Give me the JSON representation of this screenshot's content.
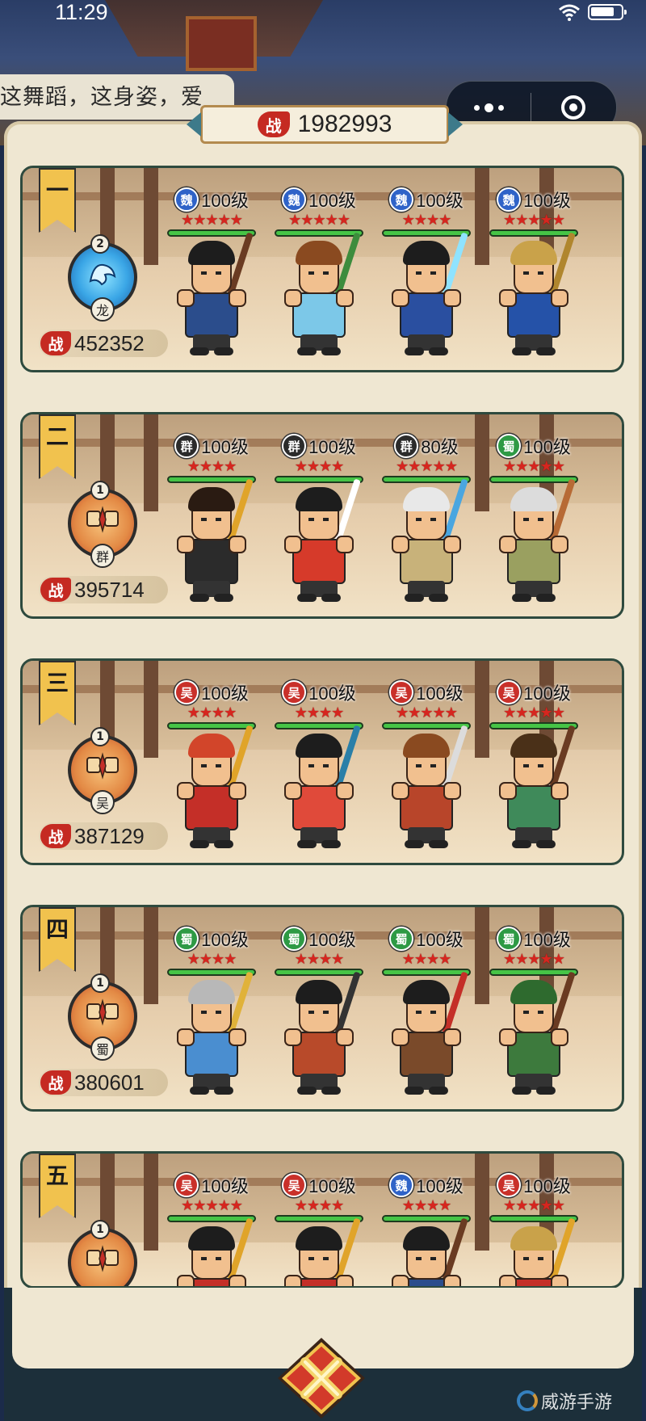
{
  "status_bar": {
    "time": "11:29"
  },
  "dialogue": {
    "text": "这舞蹈，这身姿，爱"
  },
  "total_power": {
    "badge": "战",
    "value": "1982993"
  },
  "teams": [
    {
      "rank": "一",
      "power": "452352",
      "formation_count": "2",
      "formation_label": "龙",
      "formation_style": "dragon",
      "heroes": [
        {
          "faction": "魏",
          "faction_color": "#2f63c8",
          "level": "100级",
          "stars": "★★★★★",
          "body_color": "#2b4d8c",
          "hair_color": "#1d1d1d",
          "weapon_color": "#6a3b22"
        },
        {
          "faction": "魏",
          "faction_color": "#2f63c8",
          "level": "100级",
          "stars": "★★★★★",
          "body_color": "#7cc8e8",
          "hair_color": "#8a4a20",
          "weapon_color": "#3d8c3d"
        },
        {
          "faction": "魏",
          "faction_color": "#2f63c8",
          "level": "100级",
          "stars": "★★★★",
          "body_color": "#2a4fa0",
          "hair_color": "#1d1d1d",
          "weapon_color": "#8fe3ff"
        },
        {
          "faction": "魏",
          "faction_color": "#2f63c8",
          "level": "100级",
          "stars": "★★★★★",
          "body_color": "#2552a8",
          "hair_color": "#c9a24a",
          "weapon_color": "#b0862e"
        }
      ]
    },
    {
      "rank": "二",
      "power": "395714",
      "formation_count": "1",
      "formation_label": "群",
      "formation_style": "fire",
      "heroes": [
        {
          "faction": "群",
          "faction_color": "#2b2b2b",
          "level": "100级",
          "stars": "★★★★",
          "body_color": "#2b2b2b",
          "hair_color": "#2a1b12",
          "weapon_color": "#e0a42a"
        },
        {
          "faction": "群",
          "faction_color": "#2b2b2b",
          "level": "100级",
          "stars": "★★★★",
          "body_color": "#d63a2a",
          "hair_color": "#1d1d1d",
          "weapon_color": "#ffffff"
        },
        {
          "faction": "群",
          "faction_color": "#2b2b2b",
          "level": "80级",
          "stars": "★★★★★",
          "body_color": "#c8b27a",
          "hair_color": "#e8e8e8",
          "weapon_color": "#4aa6e0"
        },
        {
          "faction": "蜀",
          "faction_color": "#2e9a45",
          "level": "100级",
          "stars": "★★★★★",
          "body_color": "#9aa060",
          "hair_color": "#dcdcdc",
          "weapon_color": "#b76a35"
        }
      ]
    },
    {
      "rank": "三",
      "power": "387129",
      "formation_count": "1",
      "formation_label": "吴",
      "formation_style": "fire",
      "heroes": [
        {
          "faction": "吴",
          "faction_color": "#c9302a",
          "level": "100级",
          "stars": "★★★★",
          "body_color": "#c42f28",
          "hair_color": "#d2452a",
          "weapon_color": "#e0a42a"
        },
        {
          "faction": "吴",
          "faction_color": "#c9302a",
          "level": "100级",
          "stars": "★★★★",
          "body_color": "#e04a3a",
          "hair_color": "#1d1d1d",
          "weapon_color": "#2a7fa8"
        },
        {
          "faction": "吴",
          "faction_color": "#c9302a",
          "level": "100级",
          "stars": "★★★★★",
          "body_color": "#b8452a",
          "hair_color": "#8a4a20",
          "weapon_color": "#dcdcdc"
        },
        {
          "faction": "吴",
          "faction_color": "#c9302a",
          "level": "100级",
          "stars": "★★★★★",
          "body_color": "#3f8a5a",
          "hair_color": "#4a3018",
          "weapon_color": "#6a3b22"
        }
      ]
    },
    {
      "rank": "四",
      "power": "380601",
      "formation_count": "1",
      "formation_label": "蜀",
      "formation_style": "fire",
      "heroes": [
        {
          "faction": "蜀",
          "faction_color": "#2e9a45",
          "level": "100级",
          "stars": "★★★★",
          "body_color": "#4a8ed0",
          "hair_color": "#b8b8b8",
          "weapon_color": "#e0b23a"
        },
        {
          "faction": "蜀",
          "faction_color": "#2e9a45",
          "level": "100级",
          "stars": "★★★★",
          "body_color": "#b84a2a",
          "hair_color": "#1d1d1d",
          "weapon_color": "#333333"
        },
        {
          "faction": "蜀",
          "faction_color": "#2e9a45",
          "level": "100级",
          "stars": "★★★★",
          "body_color": "#7a4a2a",
          "hair_color": "#1d1d1d",
          "weapon_color": "#c42f28"
        },
        {
          "faction": "蜀",
          "faction_color": "#2e9a45",
          "level": "100级",
          "stars": "★★★★★",
          "body_color": "#3d7a3d",
          "hair_color": "#2e6a2e",
          "weapon_color": "#6a3b22"
        }
      ]
    },
    {
      "rank": "五",
      "power": "",
      "formation_count": "1",
      "formation_label": "",
      "formation_style": "fire",
      "heroes": [
        {
          "faction": "吴",
          "faction_color": "#c9302a",
          "level": "100级",
          "stars": "★★★★★",
          "body_color": "#c42f28",
          "hair_color": "#1d1d1d",
          "weapon_color": "#e0a42a"
        },
        {
          "faction": "吴",
          "faction_color": "#c9302a",
          "level": "100级",
          "stars": "★★★★",
          "body_color": "#c42f28",
          "hair_color": "#1d1d1d",
          "weapon_color": "#e0a42a"
        },
        {
          "faction": "魏",
          "faction_color": "#2f63c8",
          "level": "100级",
          "stars": "★★★★",
          "body_color": "#2b4d8c",
          "hair_color": "#1d1d1d",
          "weapon_color": "#6a3b22"
        },
        {
          "faction": "吴",
          "faction_color": "#c9302a",
          "level": "100级",
          "stars": "★★★★★",
          "body_color": "#c42f28",
          "hair_color": "#c9a24a",
          "weapon_color": "#e0a42a"
        }
      ]
    }
  ],
  "watermark": {
    "text": "威游手游"
  },
  "colors": {
    "panel": "#efe7d2",
    "power_red": "#c52a22",
    "hp_green": "#46c446",
    "close_red": "#d23a2a"
  }
}
